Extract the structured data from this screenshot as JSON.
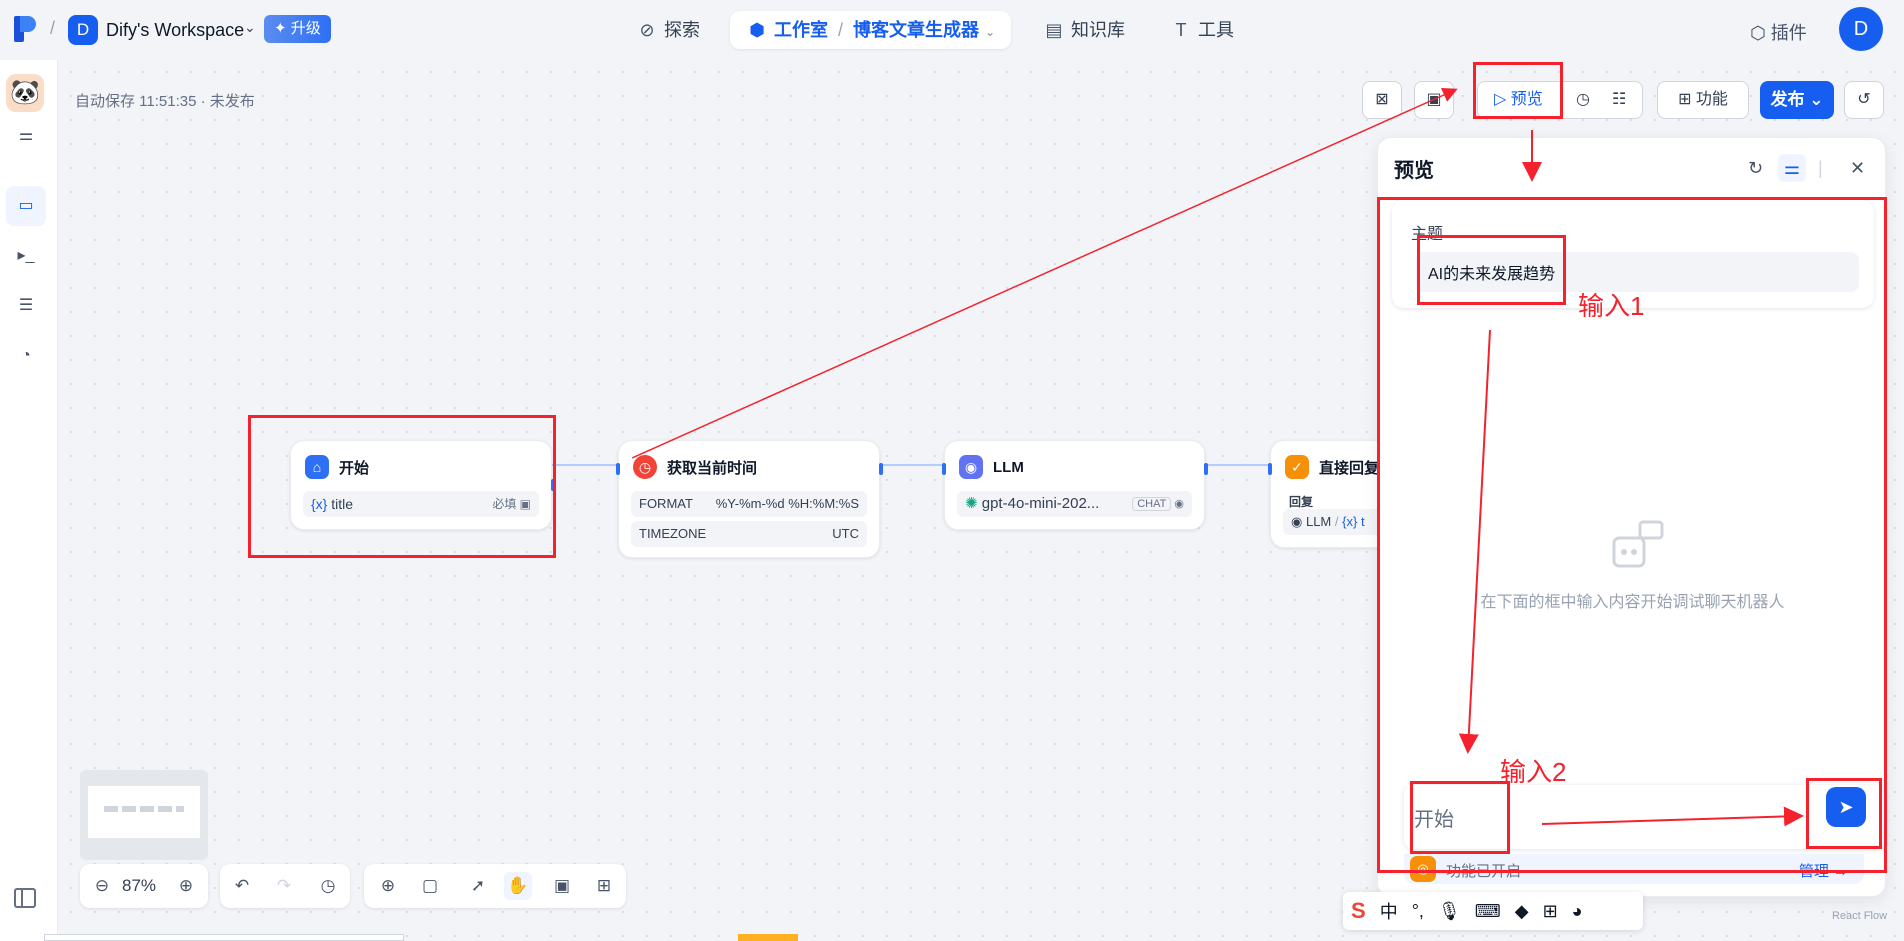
{
  "topbar": {
    "workspace_initial": "D",
    "workspace_name": "Dify's Workspace",
    "upgrade_label": "✦ 升级",
    "nav": {
      "explore": "探索",
      "studio": "工作室",
      "app_name": "博客文章生成器",
      "knowledge": "知识库",
      "tools": "工具"
    },
    "plugin_label": "插件",
    "user_initial": "D"
  },
  "canvas": {
    "autosave": "自动保存 11:51:35 · 未发布"
  },
  "nodes": {
    "start": {
      "title": "开始",
      "var_name": "title",
      "required": "必填"
    },
    "time": {
      "title": "获取当前时间",
      "format_label": "FORMAT",
      "format_value": "%Y-%m-%d %H:%M:%S",
      "tz_label": "TIMEZONE",
      "tz_value": "UTC"
    },
    "llm": {
      "title": "LLM",
      "model": "gpt-4o-mini-202...",
      "mode": "CHAT"
    },
    "answer": {
      "title": "直接回复",
      "label": "回复",
      "ref_node": "LLM",
      "ref_var": "t"
    }
  },
  "toolbar": {
    "preview": "预览",
    "features": "功能",
    "publish": "发布"
  },
  "preview_panel": {
    "title": "预览",
    "field_label": "主题",
    "field_value": "AI的未来发展趋势",
    "empty_hint": "在下面的框中输入内容开始调试聊天机器人",
    "chat_value": "开始",
    "feature_text": "功能已开启",
    "feature_manage": "管理 →"
  },
  "bottom": {
    "zoom": "87%"
  },
  "ime": {
    "lang": "中"
  },
  "footer": {
    "react_flow": "React Flow"
  },
  "annotations": {
    "input1": "输入1",
    "input2": "输入2"
  },
  "colors": {
    "brand": "#155eef",
    "annotation": "#f5222d",
    "start_icon": "#2e6ff5",
    "time_icon": "#f04438",
    "llm_icon": "#6172f3",
    "answer_icon": "#f79009"
  }
}
